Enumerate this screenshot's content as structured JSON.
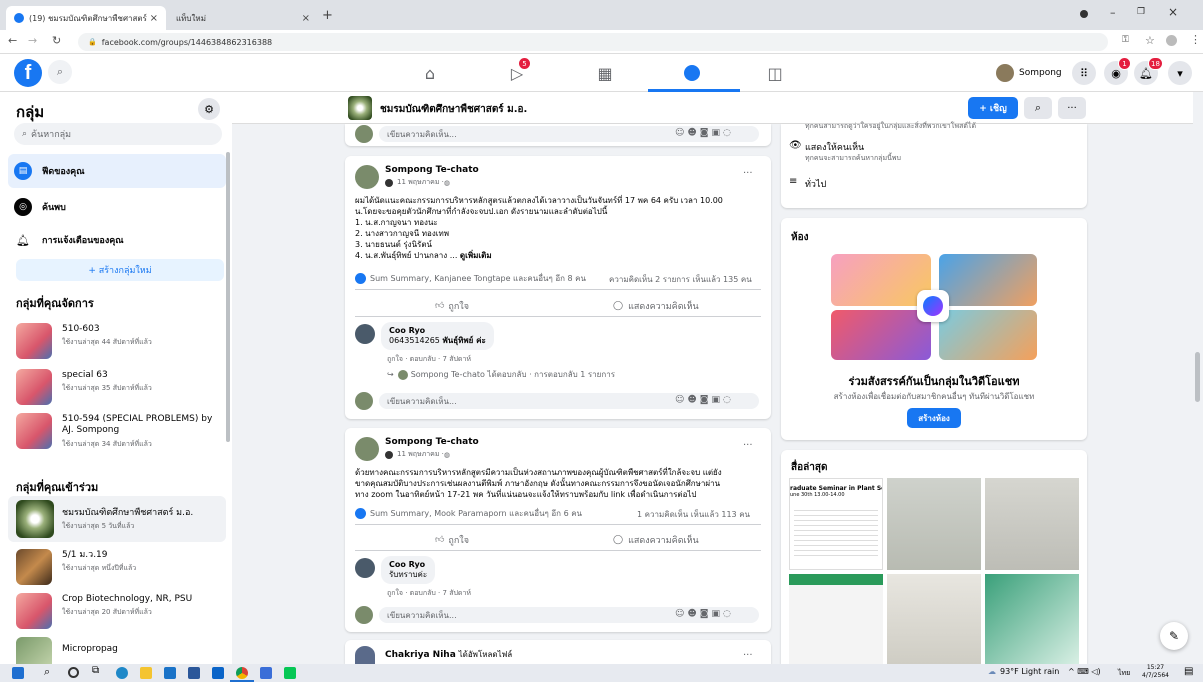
{
  "browser": {
    "tabs": [
      {
        "label": "(19) ชมรมบัณฑิตศึกษาพืชศาสตร์ ม.อ.",
        "active": true
      },
      {
        "label": "แท็บใหม่",
        "active": false
      }
    ],
    "url": "facebook.com/groups/1446384862316388"
  },
  "header": {
    "profile_name": "Sompong",
    "badges": {
      "watch": "5",
      "messenger": "1",
      "notifications": "18"
    }
  },
  "sidebar": {
    "title": "กลุ่ม",
    "search_placeholder": "ค้นหากลุ่ม",
    "nav": [
      {
        "label": "ฟีดของคุณ",
        "icon": "feed-icon"
      },
      {
        "label": "ค้นพบ",
        "icon": "compass-icon"
      },
      {
        "label": "การแจ้งเตือนของคุณ",
        "icon": "bell-icon"
      }
    ],
    "create_label": "+ สร้างกลุ่มใหม่",
    "managed_heading": "กลุ่มที่คุณจัดการ",
    "managed": [
      {
        "name": "510-603",
        "activity": "ใช้งานล่าสุด 44 สัปดาห์ที่แล้ว"
      },
      {
        "name": "special 63",
        "activity": "ใช้งานล่าสุด 35 สัปดาห์ที่แล้ว"
      },
      {
        "name": "510-594 (SPECIAL PROBLEMS) by AJ. Sompong",
        "activity": "ใช้งานล่าสุด 34 สัปดาห์ที่แล้ว"
      }
    ],
    "joined_heading": "กลุ่มที่คุณเข้าร่วม",
    "joined": [
      {
        "name": "ชมรมบัณฑิตศึกษาพืชศาสตร์ ม.อ.",
        "activity": "ใช้งานล่าสุด 5 วันที่แล้ว"
      },
      {
        "name": "5/1 ม.ว.19",
        "activity": "ใช้งานล่าสุด หนึ่งปีที่แล้ว"
      },
      {
        "name": "Crop Biotechnology, NR, PSU",
        "activity": "ใช้งานล่าสุด 20 สัปดาห์ที่แล้ว"
      },
      {
        "name": "Micropropag",
        "activity": ""
      }
    ]
  },
  "groupbar": {
    "name": "ชมรมบัณฑิตศึกษาพืชศาสตร์ ม.อ.",
    "invite_label": "+ เชิญ"
  },
  "comment_placeholder": "เขียนความคิดเห็น...",
  "posts": [
    {
      "author": "Sompong Te-chato",
      "date": "11 พฤษภาคม · ",
      "lines": [
        "ผมได้นัดแนะคณะกรรมการบริหารหลักสูตรแล้วตกลงได้เวลาวางเป็นวันจันทร์ที่ 17 พค 64 ครับ เวลา 10.00",
        "น.โดยจะขอคุยตัวนักศึกษาที่กำลังจะจบป.เอก ดังรายนามและลำดับต่อไปนี้",
        "1. น.ส.กาญจนา ทองนะ",
        "2. นางสาวกาญจนี ทองเทพ",
        "3. นายธนนต์ รุ่งนิรัตน์",
        "4. น.ส.พันธุ์ทิพย์ ปานกลาง ..."
      ],
      "see_more": "ดูเพิ่มเติม",
      "reactions": "Sum Summary, Kanjanee Tongtape และคนอื่นๆ อีก 8 คน",
      "stats": "ความคิดเห็น 2 รายการ  เห็นแล้ว 135 คน",
      "like_label": "ถูกใจ",
      "comment_label": "แสดงความคิดเห็น",
      "comment": {
        "author": "Coo Ryo",
        "text": "0643514265 ",
        "mention": "พันธุ์ทิพย์ ค่ะ",
        "meta": "ถูกใจ · ตอบกลับ · 7 สัปดาห์",
        "reply": "Sompong Te-chato ได้ตอบกลับ · การตอบกลับ 1 รายการ"
      }
    },
    {
      "author": "Sompong Te-chato",
      "date": "11 พฤษภาคม · ",
      "lines": [
        "ด้วยทางคณะกรรมการบริหารหลักสูตรมีความเป็นห่วงสถานภาพของคุณผู้บัณฑิตพืชศาสตร์ที่ใกล้จะจบ แต่ยัง",
        "ขาดคุณสมบัติบางประการเช่นผลงานตีพิมพ์ ภาษาอังกฤษ ดังนั้นทางคณะกรรมการจึงขอนัดเจอนักศึกษาผ่าน",
        "ทาง zoom ในอาทิตย์หน้า 17-21 พค วันที่แน่นอนจะแจ้งให้ทราบพร้อมกับ link เพื่อดำเนินการต่อไป"
      ],
      "reactions": "Sum Summary, Mook Paramaporn และคนอื่นๆ อีก 6 คน",
      "stats": "1 ความคิดเห็น  เห็นแล้ว 113 คน",
      "like_label": "ถูกใจ",
      "comment_label": "แสดงความคิดเห็น",
      "comment": {
        "author": "Coo Ryo",
        "text": "รับทราบค่ะ",
        "meta": "ถูกใจ · ตอบกลับ · 7 สัปดาห์"
      }
    },
    {
      "author": "Chakriya Niha",
      "action": "ได้อัพโหลดไฟล์"
    }
  ],
  "about": {
    "truncated": "ทุกคนสามารถดูว่าใครอยู่ในกลุ่มและสิ่งที่พวกเขาโพสต์ได้",
    "visible_title": "แสดงให้คนเห็น",
    "visible_desc": "ทุกคนจะสามารถค้นหากลุ่มนี้พบ",
    "general": "ทั่วไป"
  },
  "rooms": {
    "heading": "ห้อง",
    "title": "ร่วมสังสรรค์กันเป็นกลุ่มในวิดีโอแชท",
    "desc": "สร้างห้องเพื่อเชื่อมต่อกับสมาชิกคนอื่นๆ ทันทีผ่านวิดีโอแชท",
    "button": "สร้างห้อง"
  },
  "media": {
    "heading": "สื่อล่าสุด",
    "thumb1_line1": "raduate Seminar in Plant Science",
    "thumb1_line2": "une 30th  13.00-14.00"
  },
  "taskbar": {
    "weather": "93°F  Light rain",
    "lang": "ไทย",
    "time": "15:27",
    "date": "4/7/2564"
  },
  "colors": {
    "fb_blue": "#1877f2",
    "badge_red": "#e41e3f",
    "bg": "#f0f2f5"
  }
}
